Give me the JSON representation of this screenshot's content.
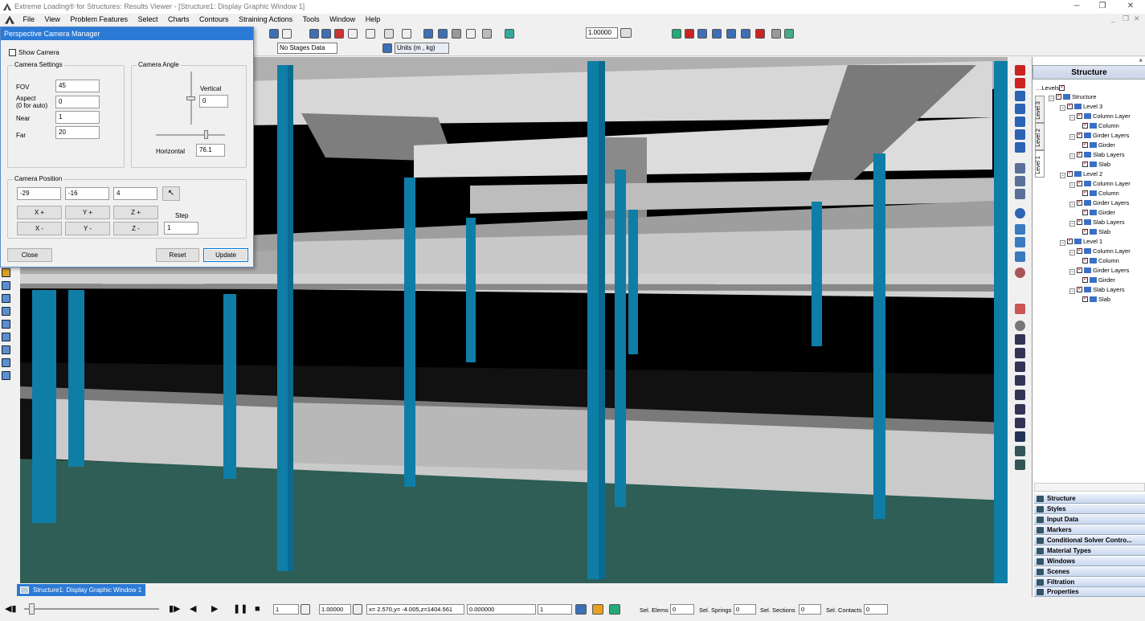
{
  "window": {
    "title": "Extreme Loading® for Structures: Results Viewer - [Structure1: Display Graphic Window 1]"
  },
  "menu": [
    "File",
    "View",
    "Problem Features",
    "Select",
    "Charts",
    "Contours",
    "Straining Actions",
    "Tools",
    "Window",
    "Help"
  ],
  "toolbar": {
    "scale_value": "1.00000",
    "stage_label": "No Stages Data",
    "units_label": "Units (m , kg)"
  },
  "dialog": {
    "title": "Perspective Camera Manager",
    "show_camera": "Show Camera",
    "settings_group": "Camera Settings",
    "fov_label": "FOV",
    "fov": "45",
    "aspect_label": "Aspect",
    "aspect_note": "(0 for auto)",
    "aspect": "0",
    "near_label": "Near",
    "near": "1",
    "far_label": "Far",
    "far": "20",
    "angle_group": "Camera Angle",
    "vertical_label": "Vertical",
    "vertical": "0",
    "horizontal_label": "Horizontal",
    "horizontal": "76.1",
    "position_group": "Camera Position",
    "pos_x": "-29",
    "pos_y": "-16",
    "pos_z": "4",
    "xplus": "X +",
    "yplus": "Y +",
    "zplus": "Z +",
    "xminus": "X -",
    "yminus": "Y -",
    "zminus": "Z -",
    "step_label": "Step",
    "step": "1",
    "close": "Close",
    "reset": "Reset",
    "update": "Update"
  },
  "panel": {
    "title": "Structure",
    "levels_label": "Levels",
    "tabs": [
      "Level 3",
      "Level 2",
      "Level 1"
    ],
    "tree": {
      "root": "Structure",
      "level3": "Level 3",
      "level2": "Level 2",
      "level1": "Level 1",
      "column_layer": "Column Layer",
      "column": "Column",
      "girder_layers": "Girder Layers",
      "girder": "Girder",
      "slab_layers": "Slab Layers",
      "slab": "Slab"
    },
    "accordion": [
      "Structure",
      "Styles",
      "Input Data",
      "Markers",
      "Conditional Solver Contro...",
      "Material Types",
      "Windows",
      "Scenes",
      "Filtration",
      "Properties"
    ]
  },
  "taskbar": {
    "window_label": "Structure1: Display Graphic Window 1"
  },
  "status": {
    "frame": "1",
    "scale": "1.00000",
    "coords": "x= 2.570,y= -4.005,z=1404.561",
    "value": "0.000000",
    "step": "1",
    "sel_elems_label": "Sel. Elems",
    "sel_elems": "0",
    "sel_springs_label": "Sel. Springs",
    "sel_springs": "0",
    "sel_sections_label": "Sel. Sections",
    "sel_sections": "0",
    "sel_contacts_label": "Sel. Contacts",
    "sel_contacts": "0"
  },
  "colors": {
    "column": "#0e7ea7",
    "slab": "#c6c6c6",
    "ground": "#2e5e55",
    "accent": "#2b7ad6"
  }
}
